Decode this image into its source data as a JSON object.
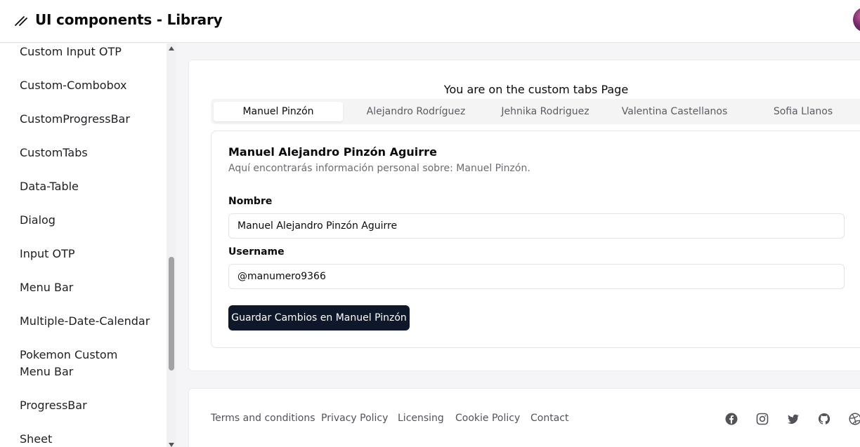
{
  "header": {
    "title": "UI components - Library"
  },
  "sidebar": {
    "items": [
      "Custom Input OTP",
      "Custom-Combobox",
      "CustomProgressBar",
      "CustomTabs",
      "Data-Table",
      "Dialog",
      "Input OTP",
      "Menu Bar",
      "Multiple-Date-Calendar",
      "Pokemon Custom Menu Bar",
      "ProgressBar",
      "Sheet"
    ]
  },
  "main": {
    "page_heading": "You are on the custom tabs Page",
    "tabs": [
      "Manuel Pinzón",
      "Alejandro Rodríguez",
      "Jehnika Rodriguez",
      "Valentina Castellanos",
      "Sofia Llanos"
    ],
    "active_tab": "Manuel Pinzón",
    "panel": {
      "title": "Manuel Alejandro Pinzón Aguirre",
      "description": "Aquí encontrarás información personal sobre: Manuel Pinzón.",
      "name_label": "Nombre",
      "name_value": "Manuel Alejandro Pinzón Aguirre",
      "username_label": "Username",
      "username_value": "@manumero9366",
      "save_button": "Guardar Cambios en Manuel Pinzón"
    }
  },
  "footer": {
    "links": [
      "Terms and conditions",
      "Privacy Policy",
      "Licensing",
      "Cookie Policy",
      "Contact"
    ],
    "social_icons": [
      "facebook-icon",
      "instagram-icon",
      "twitter-icon",
      "github-icon",
      "dribbble-icon"
    ]
  },
  "colors": {
    "primary_button": "#0f172a",
    "background": "#f5f5f7"
  }
}
